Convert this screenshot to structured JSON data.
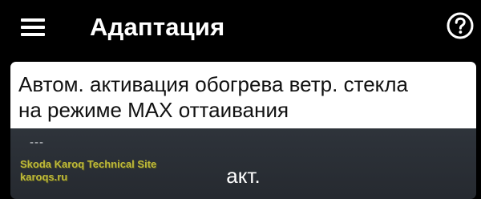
{
  "header": {
    "title": "Адаптация",
    "menu_icon": "hamburger-menu-icon",
    "help_icon": "question-circle-icon"
  },
  "setting": {
    "title": "Автом. активация обогрева ветр. стекла\nна режиме MAX оттаивания",
    "value_placeholder": "---",
    "state": "акт."
  },
  "watermark": {
    "line1": "Skoda Karoq Technical Site",
    "line2": "karoqs.ru"
  },
  "colors": {
    "background": "#000000",
    "card_bg": "#2c3138",
    "title_box_bg": "#ffffff",
    "text_on_dark": "#ffffff",
    "watermark": "#d8d23a"
  }
}
